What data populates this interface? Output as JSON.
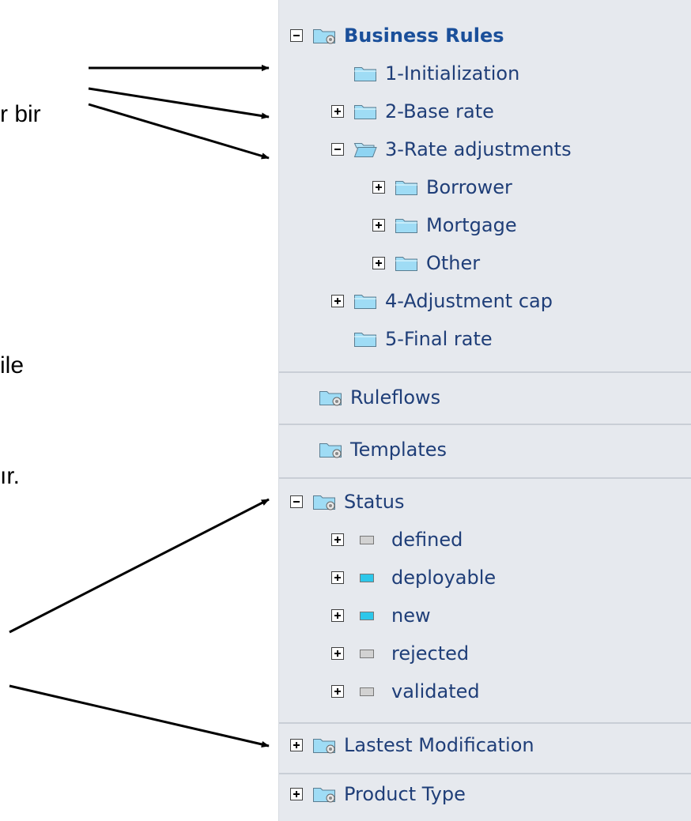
{
  "slide": {
    "text_fragments": [
      "r bir",
      "ile",
      "ır."
    ]
  },
  "tree": {
    "business_rules": {
      "label": "Business Rules",
      "children": [
        {
          "label": "1-Initialization"
        },
        {
          "label": "2-Base rate"
        },
        {
          "label": "3-Rate adjustments",
          "children": [
            {
              "label": "Borrower"
            },
            {
              "label": "Mortgage"
            },
            {
              "label": "Other"
            }
          ]
        },
        {
          "label": "4-Adjustment cap"
        },
        {
          "label": "5-Final rate"
        }
      ]
    },
    "ruleflows": {
      "label": "Ruleflows"
    },
    "templates": {
      "label": "Templates"
    },
    "status": {
      "label": "Status",
      "items": [
        {
          "label": "defined",
          "color": "#d2d2d2"
        },
        {
          "label": "deployable",
          "color": "#2cc7ea"
        },
        {
          "label": "new",
          "color": "#2cc7ea"
        },
        {
          "label": "rejected",
          "color": "#d2d2d2"
        },
        {
          "label": "validated",
          "color": "#d2d2d2"
        }
      ]
    },
    "latest_modification": {
      "label": "Lastest Modification"
    },
    "product_type": {
      "label": "Product Type"
    }
  },
  "colors": {
    "panel_bg": "#e6e9ee",
    "label_text": "#1f3e78",
    "folder_fill": "#8fd4f2"
  }
}
